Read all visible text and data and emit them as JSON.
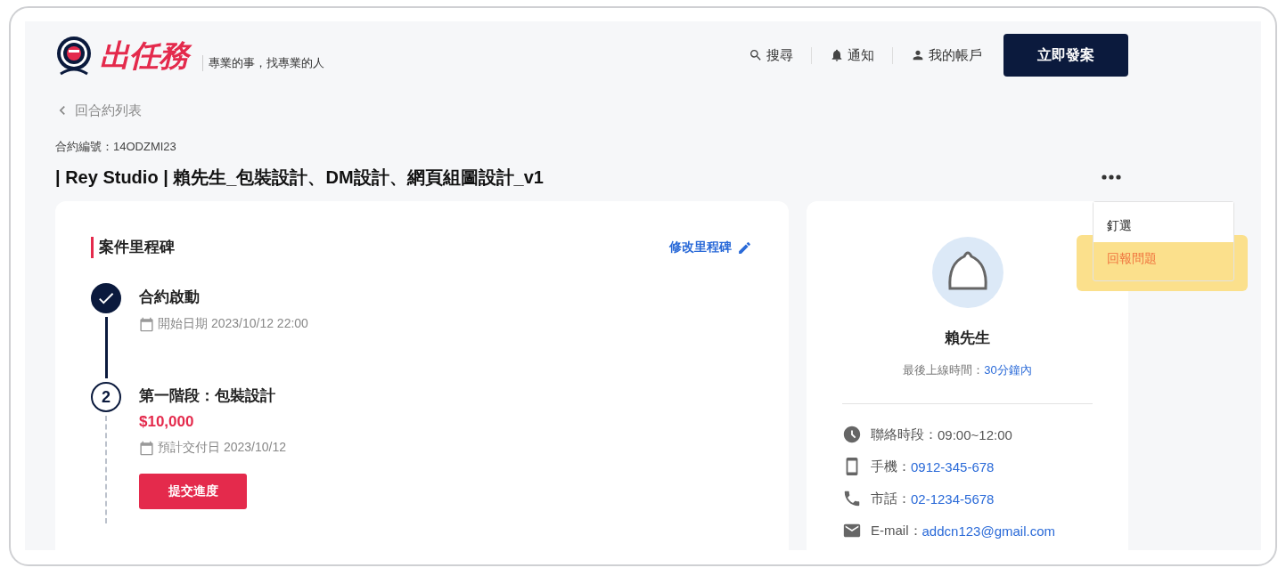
{
  "header": {
    "logo": "出任務",
    "tagline": "專業的事，找專業的人",
    "nav": [
      {
        "kind": "search",
        "label": "搜尋"
      },
      {
        "kind": "bell",
        "label": "通知"
      },
      {
        "kind": "user",
        "label": "我的帳戶"
      }
    ],
    "cta": "立即發案"
  },
  "back_link": "回合約列表",
  "contract_no": "合約編號：14ODZMI23",
  "title": "| Rey Studio | 賴先生_包裝設計、DM設計、網頁組圖設計_v1",
  "menu": {
    "items": [
      {
        "label": "釘選",
        "highlighted": false
      },
      {
        "label": "回報問題",
        "highlighted": true
      }
    ]
  },
  "milestones": {
    "heading": "案件里程碑",
    "edit_link": "修改里程碑",
    "steps": [
      {
        "kind": "done",
        "title": "合約啟動",
        "date": "開始日期 2023/10/12 22:00"
      },
      {
        "kind": "pending",
        "number": "2",
        "title": "第一階段：包裝設計",
        "amount": "$10,000",
        "date": "預計交付日 2023/10/12",
        "button": "提交進度"
      }
    ]
  },
  "profile": {
    "name": "賴先生",
    "online_label": "最後上線時間：",
    "online_value": "30分鐘內",
    "contacts": [
      {
        "kind": "clock",
        "label": "聯絡時段：",
        "value": "09:00~12:00",
        "link": false
      },
      {
        "kind": "mobile",
        "label": "手機：",
        "value": "0912-345-678",
        "link": true
      },
      {
        "kind": "phone",
        "label": "市話：",
        "value": "02-1234-5678",
        "link": true
      },
      {
        "kind": "mail",
        "label": "E-mail：",
        "value": "addcn123@gmail.com",
        "link": true
      }
    ]
  }
}
